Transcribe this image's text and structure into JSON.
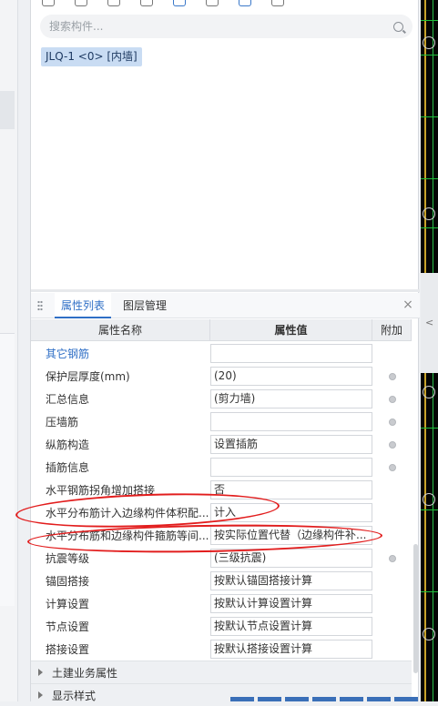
{
  "search": {
    "placeholder": "搜索构件..."
  },
  "tree": {
    "selected_item": "JLQ-1 <0> [内墙]"
  },
  "tabs": {
    "active": "属性列表",
    "other": "图层管理",
    "close": "×"
  },
  "table": {
    "headers": {
      "name": "属性名称",
      "value": "属性值",
      "extra": "附加"
    },
    "rows": [
      {
        "name": "其它钢筋",
        "value": "",
        "link": true,
        "dot": false
      },
      {
        "name": "保护层厚度(mm)",
        "value": "(20)",
        "dot": true
      },
      {
        "name": "汇总信息",
        "value": "(剪力墙)",
        "dot": true
      },
      {
        "name": "压墙筋",
        "value": "",
        "dot": true
      },
      {
        "name": "纵筋构造",
        "value": "设置插筋",
        "dot": true
      },
      {
        "name": "插筋信息",
        "value": "",
        "dot": true
      },
      {
        "name": "水平钢筋拐角增加搭接",
        "value": "否",
        "dot": false
      },
      {
        "name": "水平分布筋计入边缘构件体积配...",
        "value": "计入",
        "dot": false
      },
      {
        "name": "水平分布筋和边缘构件箍筋等间...",
        "value": "按实际位置代替（边缘构件补...",
        "dot": false
      },
      {
        "name": "抗震等级",
        "value": "(三级抗震)",
        "dot": true
      },
      {
        "name": "锚固搭接",
        "value": "按默认锚固搭接计算",
        "dot": false
      },
      {
        "name": "计算设置",
        "value": "按默认计算设置计算",
        "dot": false
      },
      {
        "name": "节点设置",
        "value": "按默认节点设置计算",
        "dot": false
      },
      {
        "name": "搭接设置",
        "value": "按默认搭接设置计算",
        "dot": false
      }
    ],
    "groups": [
      {
        "label": "土建业务属性"
      },
      {
        "label": "显示样式"
      }
    ]
  },
  "colors": {
    "accent": "#2f6fc6",
    "annotation": "#e21d1d",
    "selection": "#c9dcf3"
  }
}
